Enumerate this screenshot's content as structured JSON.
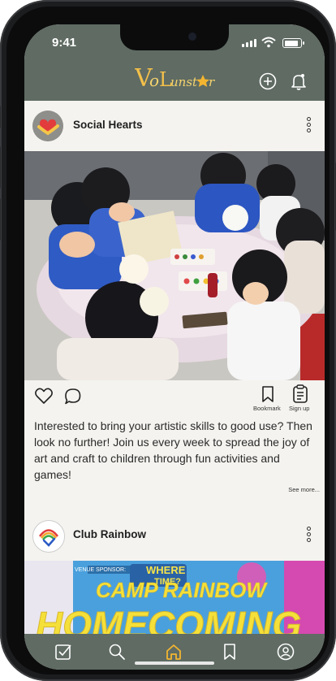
{
  "status_bar": {
    "time": "9:41"
  },
  "header": {
    "logo_main": "VoLunstar",
    "actions": [
      {
        "icon": "add-circle-icon"
      },
      {
        "icon": "bell-icon"
      }
    ]
  },
  "posts": [
    {
      "author": "Social Hearts",
      "avatar_icon": "heart-hands-logo",
      "photo_alt": "Children painting with volunteers around a table",
      "actions": {
        "bookmark_label": "Bookmark",
        "signup_label": "Sign up"
      },
      "caption": "Interested to bring your artistic skills to good use? Then look no further! Join us every week to spread the joy of art and craft to children through fun activities and games!",
      "see_more": "See more..."
    },
    {
      "author": "Club Rainbow",
      "avatar_icon": "club-rainbow-logo",
      "banner_line1": "CAMP RAINBOW",
      "banner_line2": "HOMECOMING",
      "banner_sponsor": "VENUE SPONSOR:",
      "banner_where": "WHERE",
      "banner_time": "TIME?"
    }
  ],
  "tabbar": {
    "items": [
      {
        "icon": "checkbox-icon"
      },
      {
        "icon": "search-icon"
      },
      {
        "icon": "home-icon",
        "active": true
      },
      {
        "icon": "bookmark-icon"
      },
      {
        "icon": "profile-icon"
      }
    ]
  },
  "colors": {
    "bar": "#5f6b63",
    "accent": "#f3b531",
    "background": "#f4f3ef"
  }
}
